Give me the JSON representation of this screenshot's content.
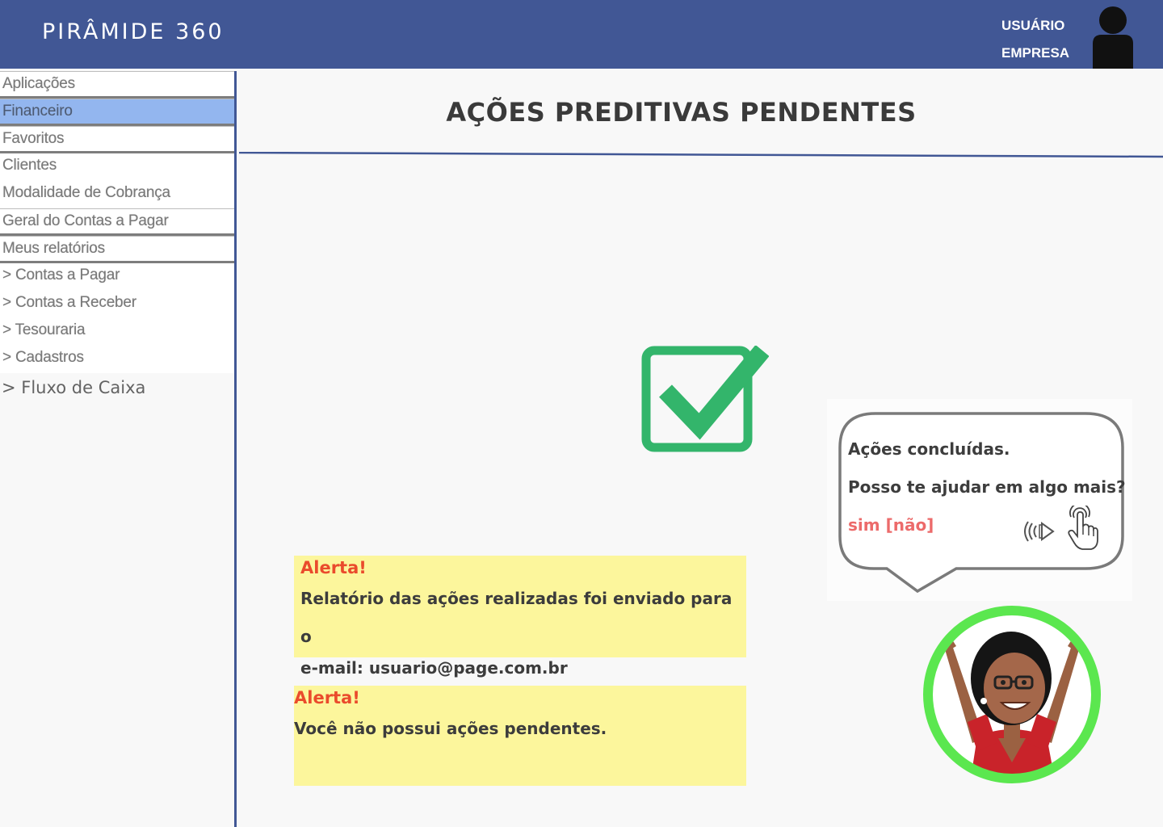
{
  "header": {
    "app_title": "PIRÂMIDE 360",
    "user_label": "USUÁRIO",
    "company_label": "EMPRESA",
    "avatar_icon": "user-silhouette-icon",
    "bg_color": "#415795"
  },
  "sidebar": {
    "items": [
      {
        "label": "Aplicações"
      },
      {
        "label": "Financeiro",
        "active": true
      },
      {
        "label": "Favoritos"
      },
      {
        "label": "Clientes"
      },
      {
        "label": "Modalidade de Cobrança"
      },
      {
        "label": "Geral do Contas a Pagar"
      },
      {
        "label": "Meus relatórios"
      },
      {
        "label": "> Contas a Pagar"
      },
      {
        "label": "> Contas a Receber"
      },
      {
        "label": "> Tesouraria"
      },
      {
        "label": "> Cadastros"
      }
    ],
    "flux_label": "> Fluxo de Caixa",
    "active_color": "#93b6ef"
  },
  "main": {
    "title": "AÇÕES PREDITIVAS PENDENTES",
    "status_icon": "check-icon",
    "alerts": [
      {
        "heading": "Alerta!",
        "line1": "Relatório das ações realizadas foi enviado para o",
        "line2": "e-mail: usuario@page.com.br"
      },
      {
        "heading": "Alerta!",
        "line1": "Você não possui ações pendentes."
      }
    ],
    "alert_color": "#fcf69c",
    "alert_heading_color": "#ea4b2c"
  },
  "assistant": {
    "line1": "Ações concluídas.",
    "line2": "Posso te ajudar em algo mais?",
    "options": "sim [não]",
    "speaker_icon": "speaker-icon",
    "touch_icon": "touch-icon",
    "avatar_icon": "assistant-avatar-icon",
    "ring_color": "#5be74f"
  }
}
